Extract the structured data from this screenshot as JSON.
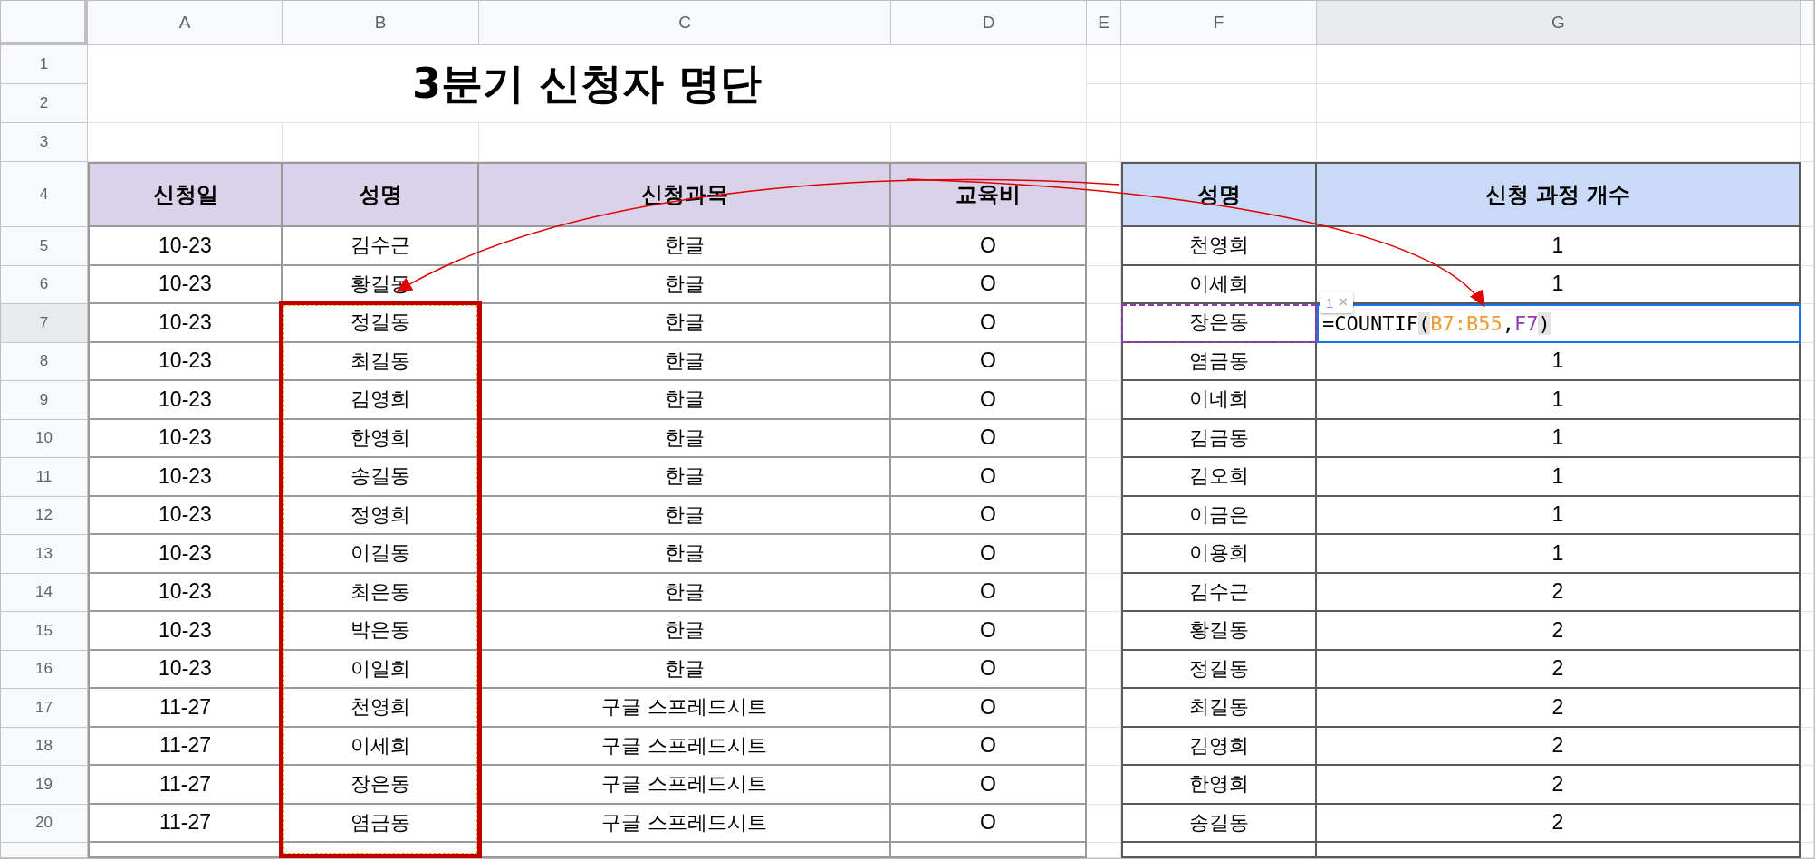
{
  "column_headers": [
    {
      "label": "A",
      "selected": false
    },
    {
      "label": "B",
      "selected": false
    },
    {
      "label": "C",
      "selected": false
    },
    {
      "label": "D",
      "selected": false
    },
    {
      "label": "E",
      "selected": false
    },
    {
      "label": "F",
      "selected": false
    },
    {
      "label": "G",
      "selected": true
    }
  ],
  "row_headers": [
    {
      "label": "1",
      "selected": false
    },
    {
      "label": "2",
      "selected": false
    },
    {
      "label": "3",
      "selected": false
    },
    {
      "label": "4",
      "selected": false
    },
    {
      "label": "5",
      "selected": false
    },
    {
      "label": "6",
      "selected": false
    },
    {
      "label": "7",
      "selected": true
    },
    {
      "label": "8",
      "selected": false
    },
    {
      "label": "9",
      "selected": false
    },
    {
      "label": "10",
      "selected": false
    },
    {
      "label": "11",
      "selected": false
    },
    {
      "label": "12",
      "selected": false
    },
    {
      "label": "13",
      "selected": false
    },
    {
      "label": "14",
      "selected": false
    },
    {
      "label": "15",
      "selected": false
    },
    {
      "label": "16",
      "selected": false
    },
    {
      "label": "17",
      "selected": false
    },
    {
      "label": "18",
      "selected": false
    },
    {
      "label": "19",
      "selected": false
    },
    {
      "label": "20",
      "selected": false
    }
  ],
  "title": "3분기 신청자 명단",
  "left_table": {
    "columns": [
      "신청일",
      "성명",
      "신청과목",
      "교육비"
    ],
    "rows": [
      [
        "10-23",
        "김수근",
        "한글",
        "O"
      ],
      [
        "10-23",
        "황길동",
        "한글",
        "O"
      ],
      [
        "10-23",
        "정길동",
        "한글",
        "O"
      ],
      [
        "10-23",
        "최길동",
        "한글",
        "O"
      ],
      [
        "10-23",
        "김영희",
        "한글",
        "O"
      ],
      [
        "10-23",
        "한영희",
        "한글",
        "O"
      ],
      [
        "10-23",
        "송길동",
        "한글",
        "O"
      ],
      [
        "10-23",
        "정영희",
        "한글",
        "O"
      ],
      [
        "10-23",
        "이길동",
        "한글",
        "O"
      ],
      [
        "10-23",
        "최은동",
        "한글",
        "O"
      ],
      [
        "10-23",
        "박은동",
        "한글",
        "O"
      ],
      [
        "10-23",
        "이일희",
        "한글",
        "O"
      ],
      [
        "11-27",
        "천영희",
        "구글 스프레드시트",
        "O"
      ],
      [
        "11-27",
        "이세희",
        "구글 스프레드시트",
        "O"
      ],
      [
        "11-27",
        "장은동",
        "구글 스프레드시트",
        "O"
      ],
      [
        "11-27",
        "염금동",
        "구글 스프레드시트",
        "O"
      ]
    ]
  },
  "right_table": {
    "columns": [
      "성명",
      "신청 과정 개수"
    ],
    "rows": [
      {
        "name": "천영희",
        "count": "1"
      },
      {
        "name": "이세희",
        "count": "1"
      },
      {
        "name": "장은동",
        "formula": [
          {
            "kind": "text",
            "text": "=COUNTIF"
          },
          {
            "kind": "paren",
            "text": "("
          },
          {
            "kind": "ref",
            "text": "B7:B55",
            "color": "#f09a36"
          },
          {
            "kind": "text",
            "text": ","
          },
          {
            "kind": "ref",
            "text": "F7",
            "color": "#8e3fae"
          },
          {
            "kind": "paren",
            "text": ")"
          }
        ]
      },
      {
        "name": "염금동",
        "count": "1"
      },
      {
        "name": "이네희",
        "count": "1"
      },
      {
        "name": "김금동",
        "count": "1"
      },
      {
        "name": "김오희",
        "count": "1"
      },
      {
        "name": "이금은",
        "count": "1"
      },
      {
        "name": "이용희",
        "count": "1"
      },
      {
        "name": "김수근",
        "count": "2"
      },
      {
        "name": "황길동",
        "count": "2"
      },
      {
        "name": "정길동",
        "count": "2"
      },
      {
        "name": "최길동",
        "count": "2"
      },
      {
        "name": "김영희",
        "count": "2"
      },
      {
        "name": "한영희",
        "count": "2"
      },
      {
        "name": "송길동",
        "count": "2"
      }
    ]
  },
  "formula_hint": {
    "count": "1",
    "close": "×"
  }
}
